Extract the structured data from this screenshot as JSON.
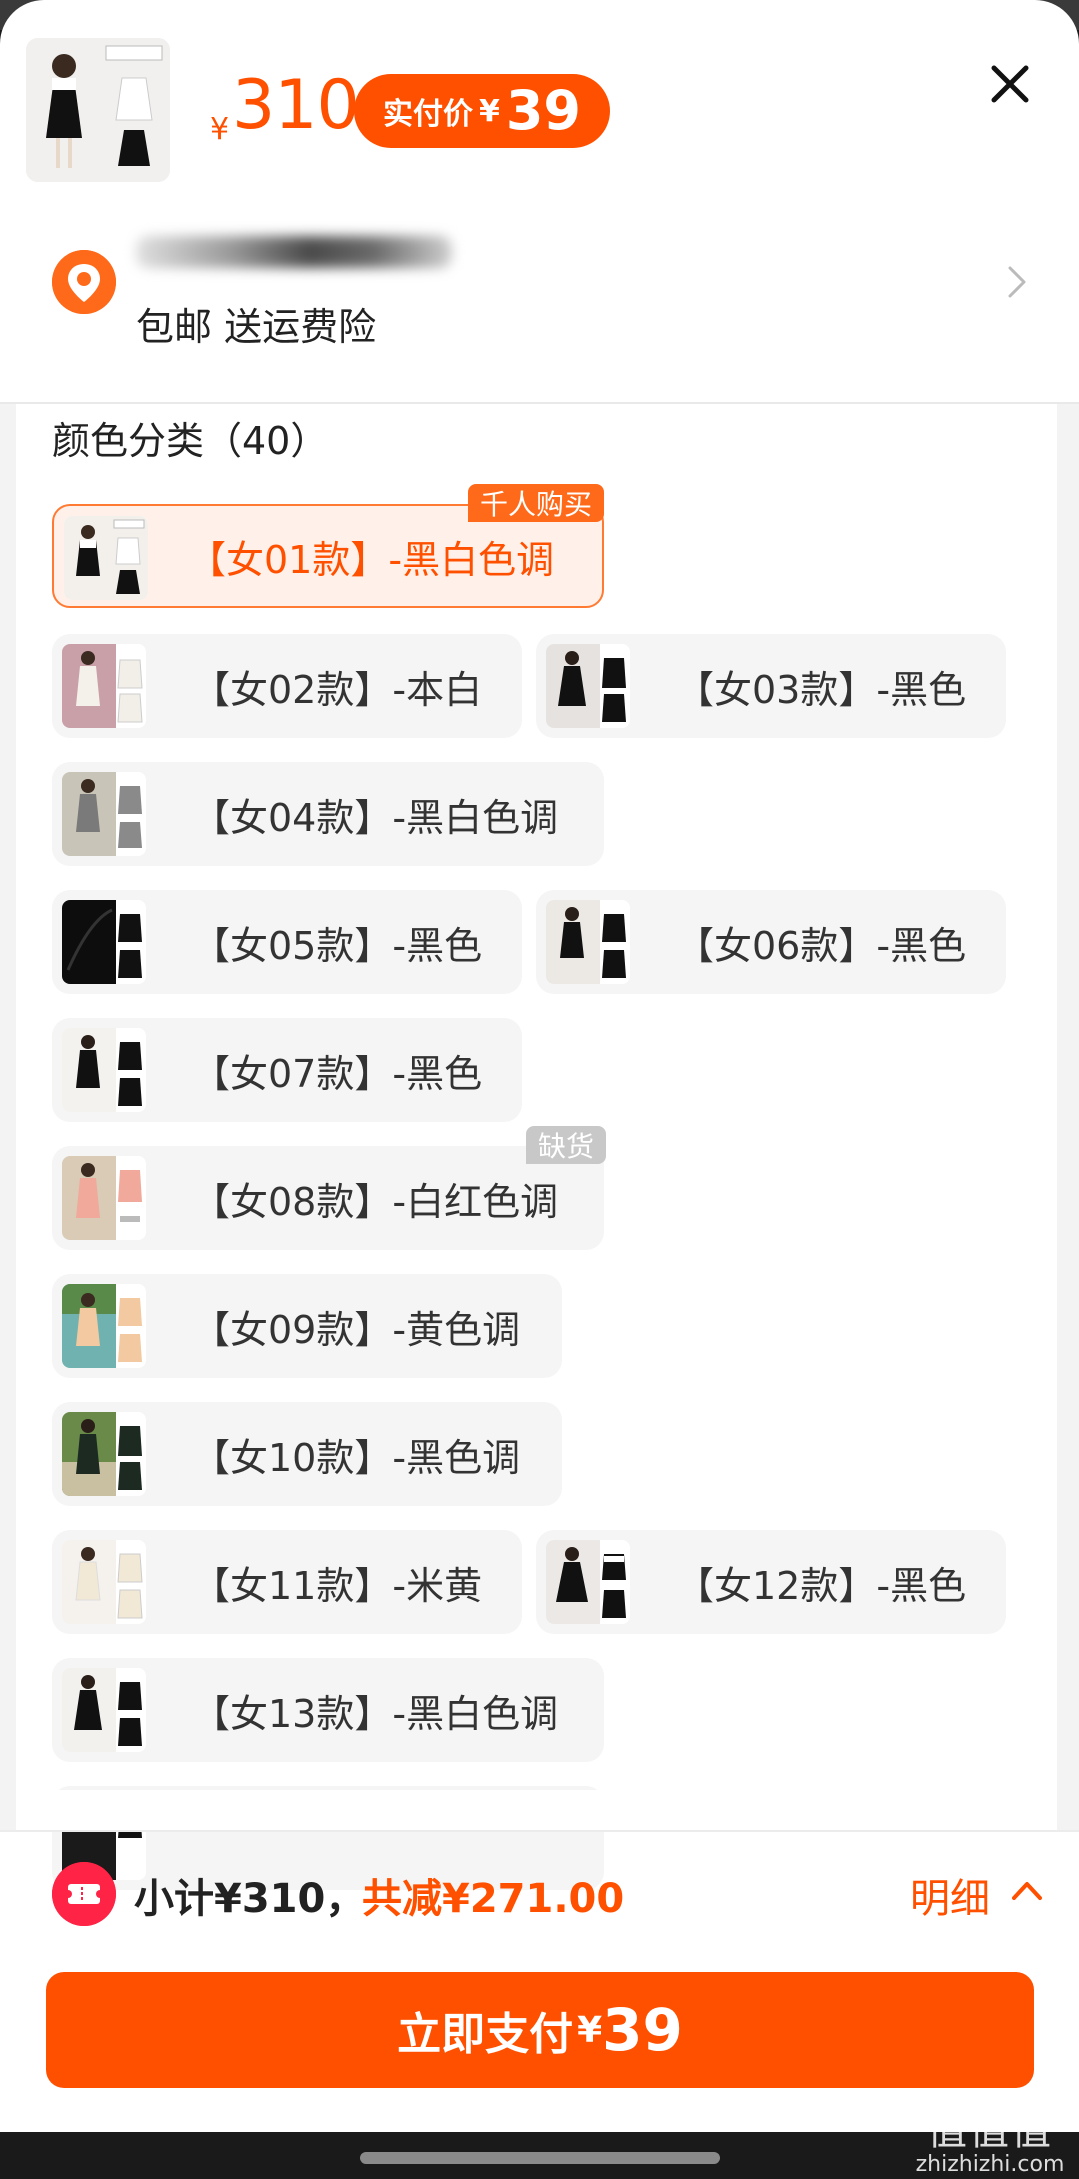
{
  "header": {
    "price_symbol": "¥",
    "price": "310",
    "pay_label": "实付价",
    "pay_symbol": "¥",
    "pay_amount": "39"
  },
  "address": {
    "shipping_text": "包邮 送运费险"
  },
  "section": {
    "title": "颜色分类（40）"
  },
  "variants": [
    {
      "label": "【女01款】-黑白色调",
      "tag": "千人购买",
      "selected": true
    },
    {
      "label": "【女02款】-本白"
    },
    {
      "label": "【女03款】-黑色"
    },
    {
      "label": "【女04款】-黑白色调"
    },
    {
      "label": "【女05款】-黑色"
    },
    {
      "label": "【女06款】-黑色"
    },
    {
      "label": "【女07款】-黑色"
    },
    {
      "label": "【女08款】-白红色调",
      "tag": "缺货"
    },
    {
      "label": "【女09款】-黄色调"
    },
    {
      "label": "【女10款】-黑色调"
    },
    {
      "label": "【女11款】-米黄"
    },
    {
      "label": "【女12款】-黑色"
    },
    {
      "label": "【女13款】-黑白色调"
    }
  ],
  "footer": {
    "subtotal": "小计¥310，",
    "discount": "共减¥271.00",
    "detail_label": "明细",
    "pay_button_label": "立即支付",
    "pay_button_symbol": "¥",
    "pay_button_amount": "39"
  },
  "watermark": {
    "line1": "值值值",
    "line2": "zhizhizhi.com"
  },
  "colors": {
    "accent": "#ff5000",
    "accent_light": "#fff1ea",
    "chip_bg": "#f5f5f5",
    "coupon_red": "#ff2446"
  },
  "icons": [
    "close-icon",
    "location-pin-icon",
    "chevron-right-icon",
    "coupon-icon",
    "chevron-up-icon"
  ]
}
